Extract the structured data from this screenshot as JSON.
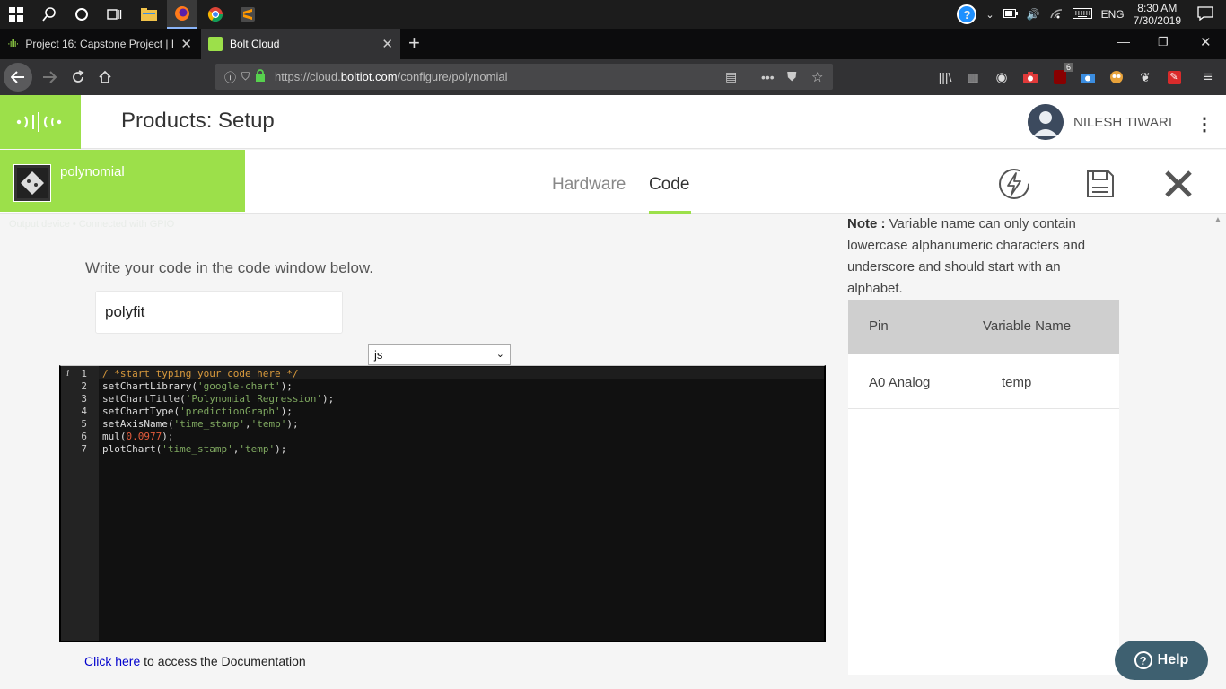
{
  "taskbar": {
    "clock_time": "8:30 AM",
    "clock_date": "7/30/2019",
    "language": "ENG",
    "help_icon": "question-circle-icon"
  },
  "browser": {
    "tabs": [
      {
        "label": "Project 16: Capstone Project | B"
      },
      {
        "label": "Bolt Cloud"
      }
    ],
    "url_prefix": "https://cloud.",
    "url_host": "boltiot.com",
    "url_path": "/configure/polynomial",
    "extension_badge": "6"
  },
  "app": {
    "page_title": "Products: Setup",
    "user_name": "NILESH TIWARI",
    "device_name": "polynomial",
    "device_status": "Output device • Connected with GPIO",
    "tabs": {
      "hardware": "Hardware",
      "code": "Code"
    },
    "accent_color": "#9ce04a"
  },
  "main": {
    "instruction": "Write your code in the code window below.",
    "product_name_value": "polyfit",
    "language_selected": "js",
    "code_lines": [
      "/ *start typing your code here */",
      "setChartLibrary('google-chart');",
      "setChartTitle('Polynomial Regression');",
      "setChartType('predictionGraph');",
      "setAxisName('time_stamp','temp');",
      "mul(0.0977);",
      "plotChart('time_stamp','temp');"
    ],
    "line_numbers": [
      "1",
      "2",
      "3",
      "4",
      "5",
      "6",
      "7"
    ],
    "docs_link": "Click here",
    "docs_text": " to access the Documentation"
  },
  "note": {
    "label": "Note :",
    "text": " Variable name can only contain lowercase alphanumeric characters and underscore and should start with an alphabet."
  },
  "pin_table": {
    "headers": {
      "pin": "Pin",
      "variable": "Variable Name"
    },
    "rows": [
      {
        "pin": "A0 Analog",
        "variable": "temp"
      }
    ]
  },
  "help_button": "Help"
}
